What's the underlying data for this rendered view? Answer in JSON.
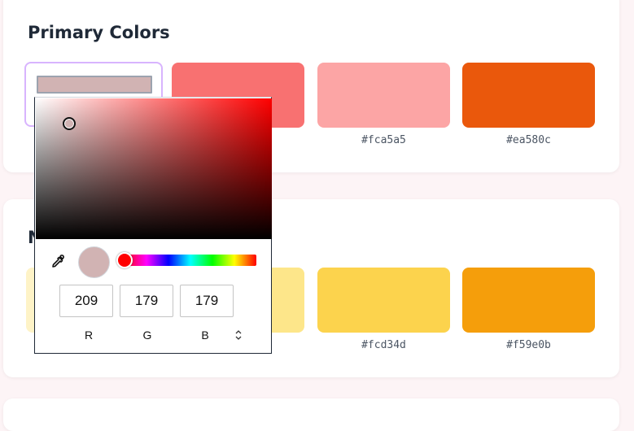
{
  "sections": [
    {
      "title": "Primary Colors",
      "swatches": [
        {
          "hex": "",
          "color": "#d1b3b3"
        },
        {
          "hex": "",
          "color": "#f87171"
        },
        {
          "hex": "#fca5a5",
          "color": "#fca5a5"
        },
        {
          "hex": "#ea580c",
          "color": "#ea580c"
        }
      ]
    },
    {
      "title": "N",
      "swatches": [
        {
          "hex": "",
          "color": "#fef3c7"
        },
        {
          "hex": "",
          "color": "#fde68a"
        },
        {
          "hex": "#fcd34d",
          "color": "#fcd34d"
        },
        {
          "hex": "#f59e0b",
          "color": "#f59e0b"
        }
      ]
    }
  ],
  "picker": {
    "current_color": "#d1b3b3",
    "hue_color": "#ff0000",
    "hue_degrees": 0,
    "saturation": 0.14,
    "value": 0.82,
    "r": "209",
    "g": "179",
    "b": "179",
    "r_label": "R",
    "g_label": "G",
    "b_label": "B",
    "icons": {
      "eyedropper": "eyedropper-icon",
      "mode_toggle": "chevron-updown-icon"
    }
  }
}
